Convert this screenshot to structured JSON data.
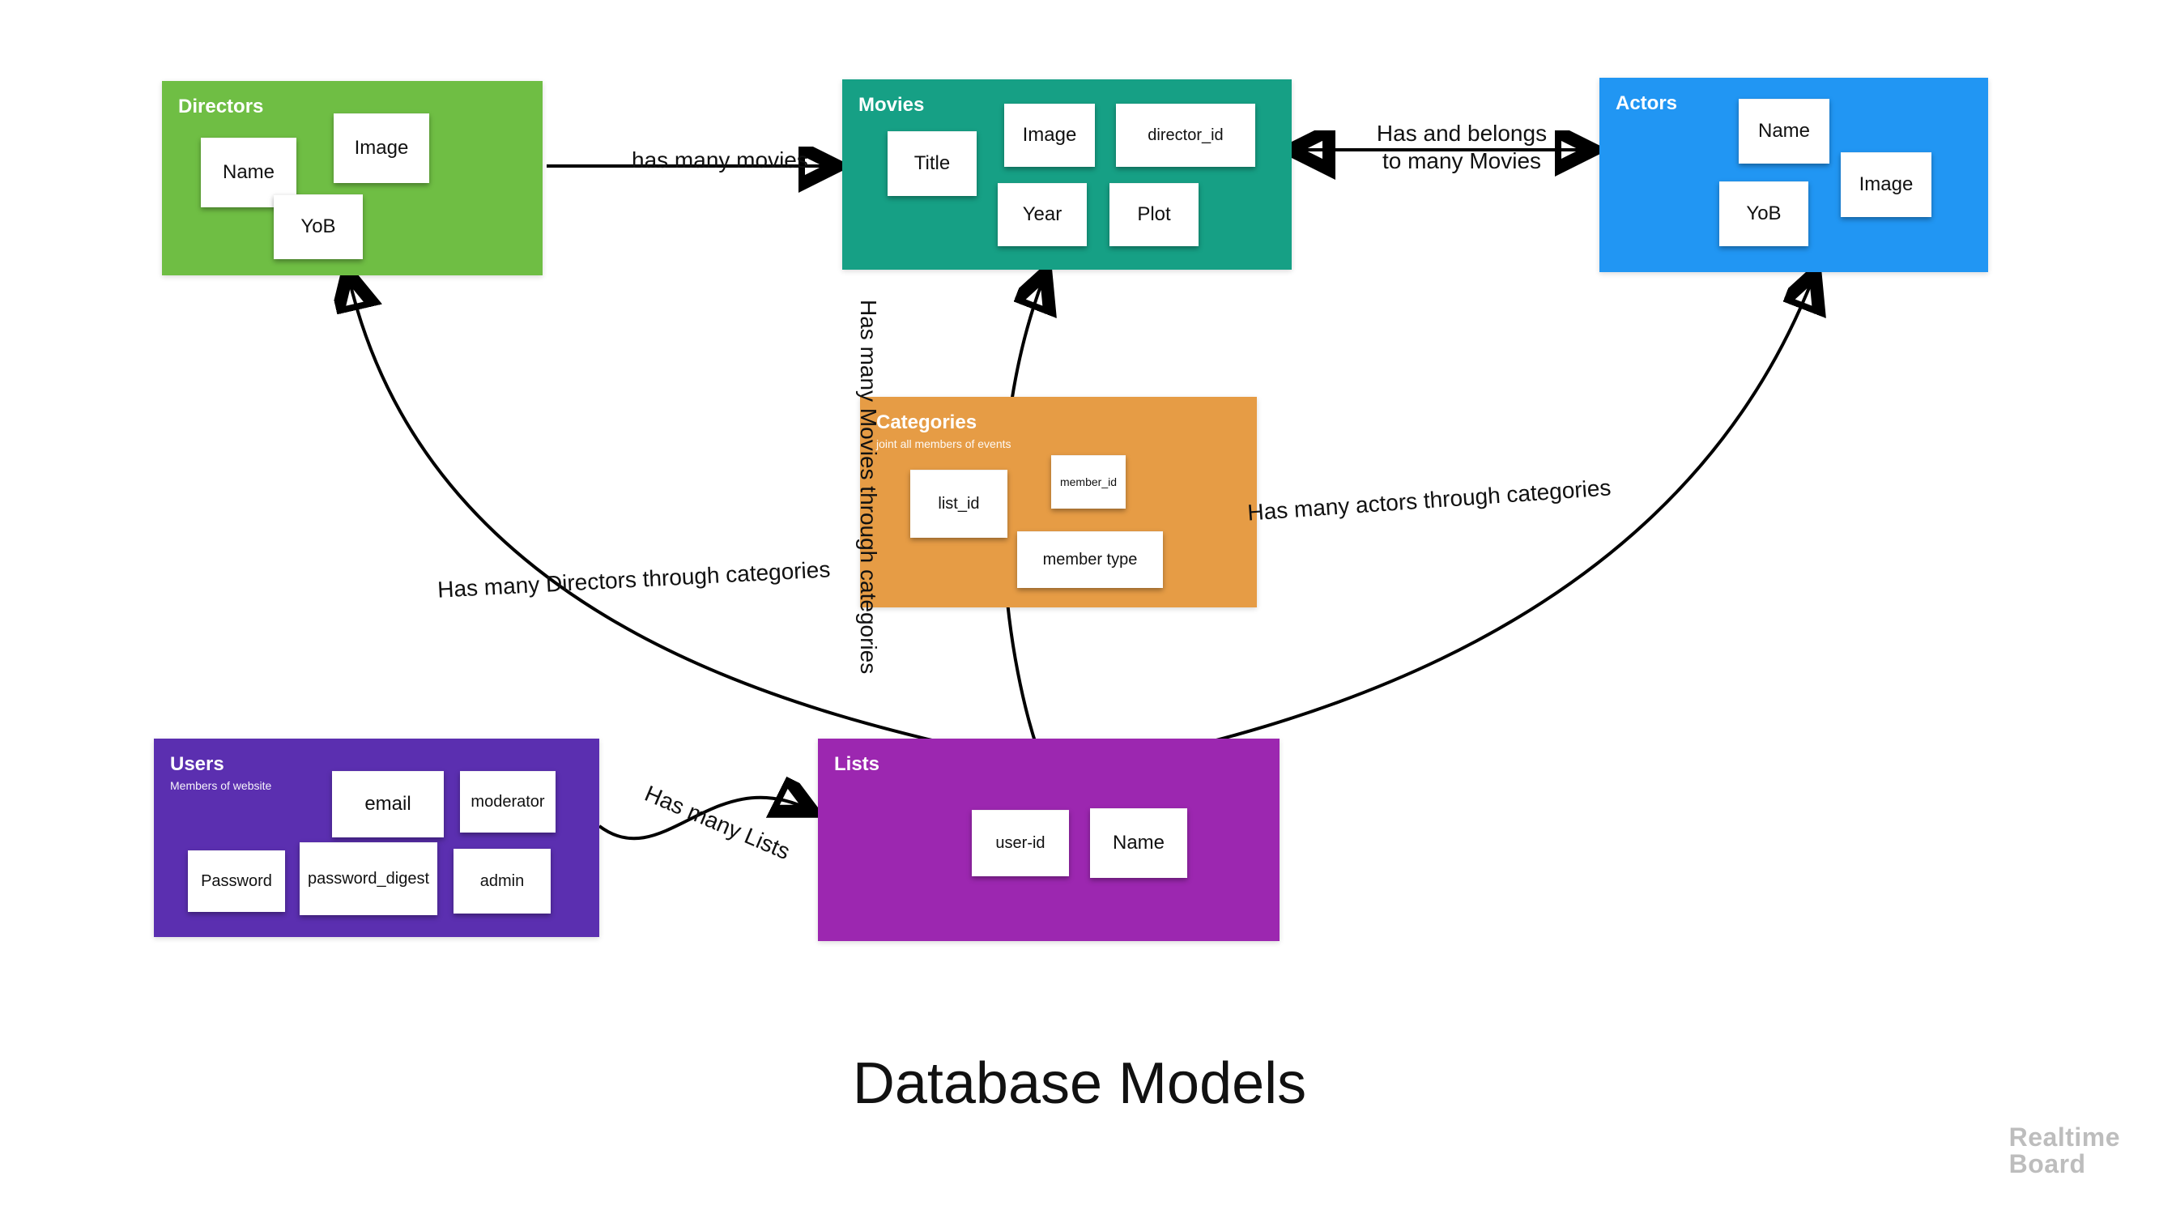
{
  "title": "Database Models",
  "watermark_line1": "Realtime",
  "watermark_line2": "Board",
  "colors": {
    "directors": "#6fbe44",
    "movies": "#16a085",
    "actors": "#2196f3",
    "categories": "#e69c45",
    "users": "#5b2fb0",
    "lists": "#9c27b0"
  },
  "entities": {
    "directors": {
      "title": "Directors",
      "subtitle": "",
      "fields": {
        "name": "Name",
        "image": "Image",
        "yob": "YoB"
      }
    },
    "movies": {
      "title": "Movies",
      "subtitle": "",
      "fields": {
        "title": "Title",
        "image": "Image",
        "director_id": "director_id",
        "year": "Year",
        "plot": "Plot"
      }
    },
    "actors": {
      "title": "Actors",
      "subtitle": "",
      "fields": {
        "name": "Name",
        "image": "Image",
        "yob": "YoB"
      }
    },
    "categories": {
      "title": "Categories",
      "subtitle": "joint all members of events",
      "fields": {
        "list_id": "list_id",
        "member_id": "member_id",
        "member_type": "member type"
      }
    },
    "users": {
      "title": "Users",
      "subtitle": "Members of website",
      "fields": {
        "email": "email",
        "moderator": "moderator",
        "password": "Password",
        "password_digest": "password_digest",
        "admin": "admin"
      }
    },
    "lists": {
      "title": "Lists",
      "subtitle": "",
      "fields": {
        "user_id": "user-id",
        "name": "Name"
      }
    }
  },
  "relationships": {
    "directors_movies": "has many movies",
    "movies_actors_line1": "Has and belongs",
    "movies_actors_line2": "to many Movies",
    "cats_directors": "Has many Directors through categories",
    "cats_movies": "Has many Movies through categories",
    "cats_actors": "Has many actors through categories",
    "users_lists": "Has many Lists"
  }
}
